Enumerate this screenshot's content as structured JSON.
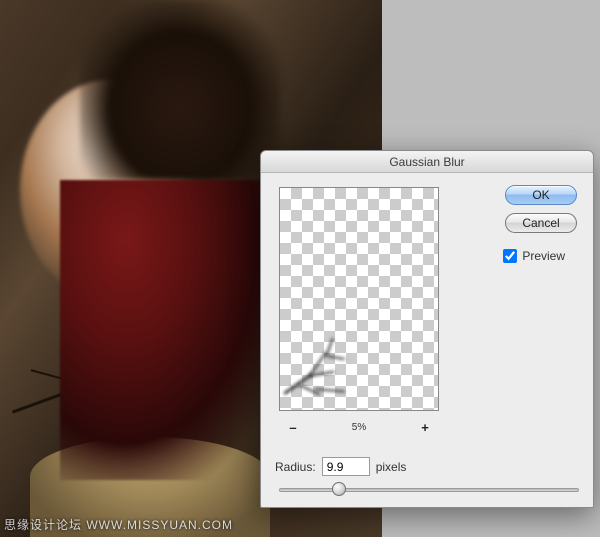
{
  "watermark": "思缘设计论坛  WWW.MISSYUAN.COM",
  "dialog": {
    "title": "Gaussian Blur",
    "ok_label": "OK",
    "cancel_label": "Cancel",
    "preview_label": "Preview",
    "preview_checked": true,
    "zoom": {
      "minus": "–",
      "plus": "+",
      "value": "5%"
    },
    "radius": {
      "label": "Radius:",
      "value": "9.9",
      "unit": "pixels"
    }
  }
}
